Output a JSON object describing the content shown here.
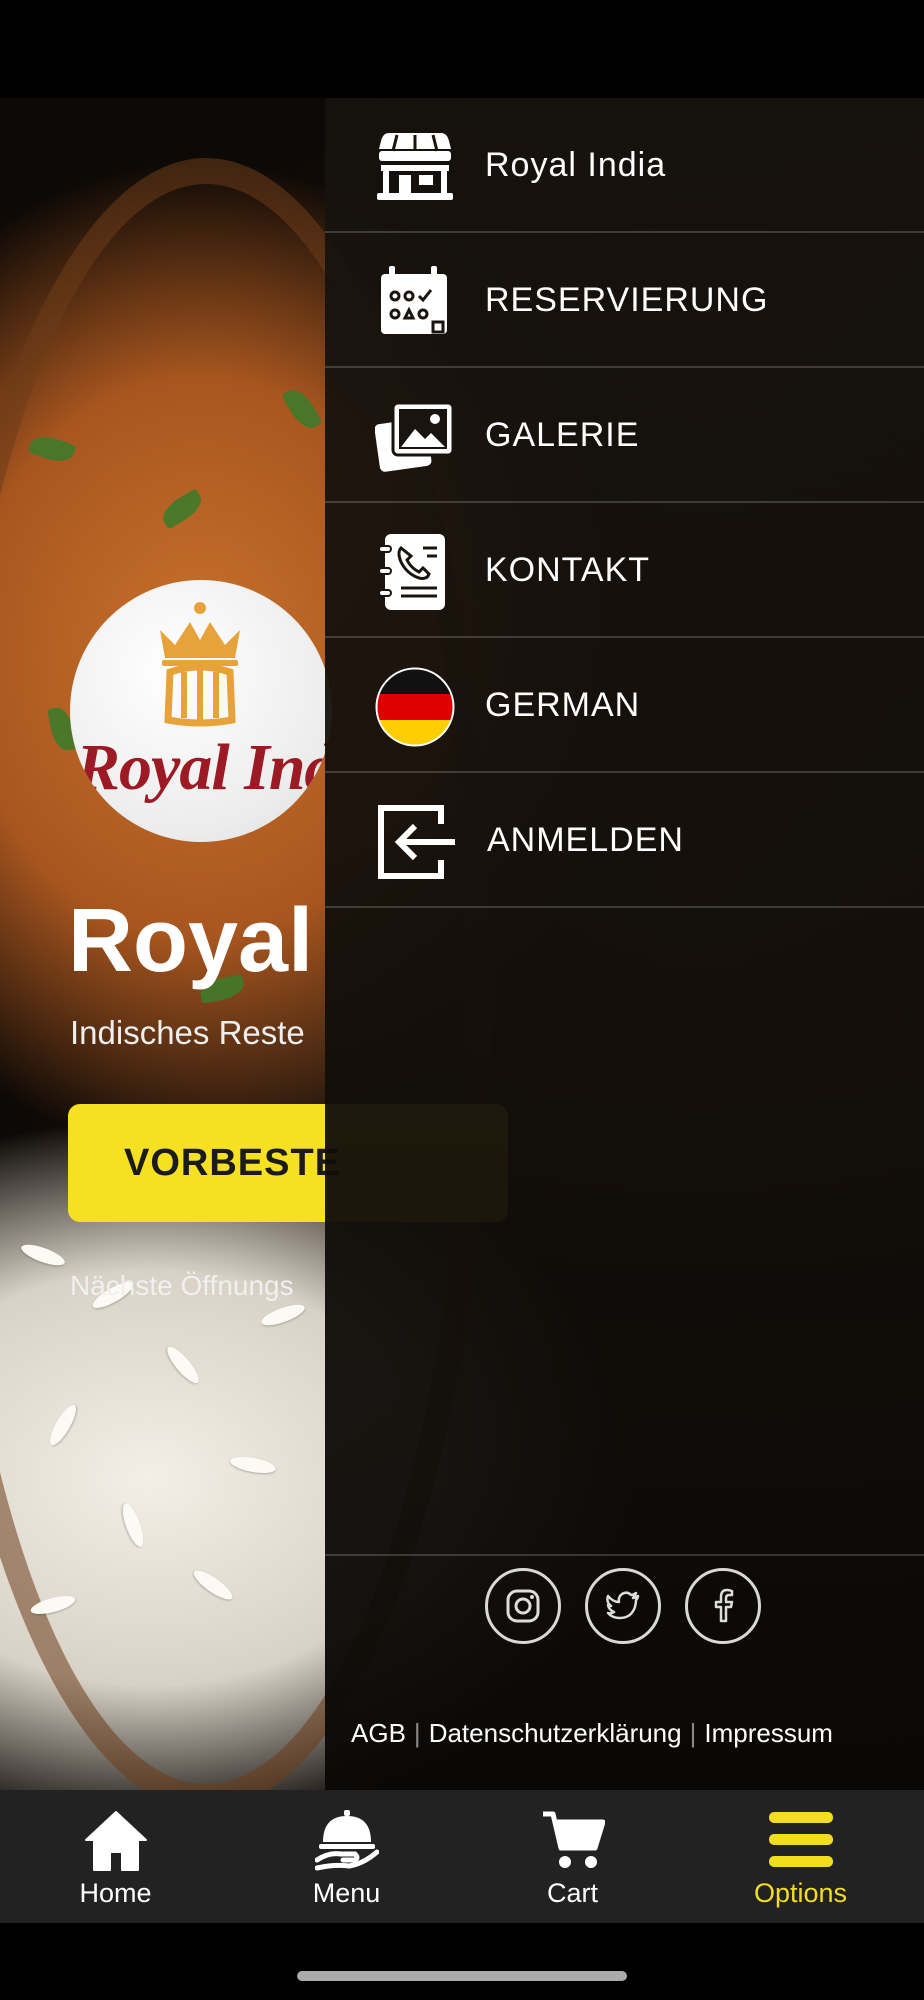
{
  "drawer": {
    "items": [
      {
        "label": "Royal India",
        "icon": "store-icon"
      },
      {
        "label": "RESERVIERUNG",
        "icon": "calendar-icon"
      },
      {
        "label": "GALERIE",
        "icon": "gallery-icon"
      },
      {
        "label": "KONTAKT",
        "icon": "contact-book-icon"
      },
      {
        "label": "GERMAN",
        "icon": "german-flag-icon"
      },
      {
        "label": "ANMELDEN",
        "icon": "login-icon"
      }
    ],
    "social": [
      "instagram-icon",
      "twitter-icon",
      "facebook-icon"
    ],
    "legal": {
      "agb": "AGB",
      "privacy": "Datenschutzerklärung",
      "imprint": "Impressum"
    }
  },
  "home": {
    "logo_text": "Royal India",
    "title": "Royal",
    "subtitle": "Indisches Reste",
    "preorder_label": "VORBESTE",
    "hours_text": "Nächste Öffnungs"
  },
  "tabbar": {
    "tabs": [
      {
        "label": "Home",
        "icon": "house-icon"
      },
      {
        "label": "Menu",
        "icon": "cloche-icon"
      },
      {
        "label": "Cart",
        "icon": "cart-icon"
      },
      {
        "label": "Options",
        "icon": "hamburger-icon",
        "active": true
      }
    ]
  },
  "colors": {
    "accent": "#f2dd1f",
    "button": "#f6e022",
    "logo_red": "#9b1a24",
    "logo_gold": "#e8a23a"
  }
}
